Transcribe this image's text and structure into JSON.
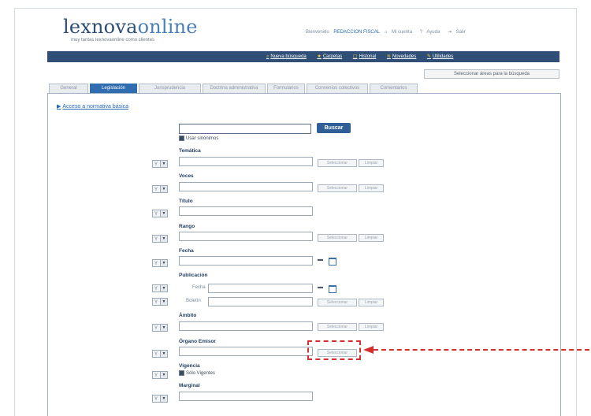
{
  "header": {
    "logo_bold": "lexnova",
    "logo_light": "online",
    "tagline": "muy tantas lexnovaonline como clientes",
    "user_label": "Bienvenido",
    "user_name": "REDACCION FISCAL",
    "my_account": "Mi cuenta",
    "help": "Ayuda",
    "logout": "Salir"
  },
  "nav": {
    "items": [
      "Nueva búsqueda",
      "Carpetas",
      "Historial",
      "Novedades",
      "Utilidades"
    ]
  },
  "selector_button": "Seleccionar áreas para la búsqueda",
  "tabs": [
    {
      "label": "General"
    },
    {
      "label": "Legislación"
    },
    {
      "label": "Jurisprudencia"
    },
    {
      "label": "Doctrina administrativa"
    },
    {
      "label": "Formularios"
    },
    {
      "label": "Convenios colectivos"
    },
    {
      "label": "Comentarios"
    }
  ],
  "access_link": "Acceso a normativa básica",
  "search": {
    "button": "Buscar",
    "synonyms_label": "Usar sinónimos"
  },
  "fields": {
    "tematica": "Temática",
    "voces": "Voces",
    "titulo": "Título",
    "rango": "Rango",
    "fecha": "Fecha",
    "publicacion": "Publicación",
    "pub_fecha": "Fecha",
    "pub_boletin": "Boletín",
    "ambito": "Ámbito",
    "organo": "Órgano Emisor",
    "vigencia": "Vigencia",
    "solo_vigentes": "Sólo Vigentes",
    "marginal": "Marginal"
  },
  "operator_value": "Y",
  "small_buttons": {
    "seleccionar": "Seleccionar",
    "limpiar": "Limpiar"
  }
}
